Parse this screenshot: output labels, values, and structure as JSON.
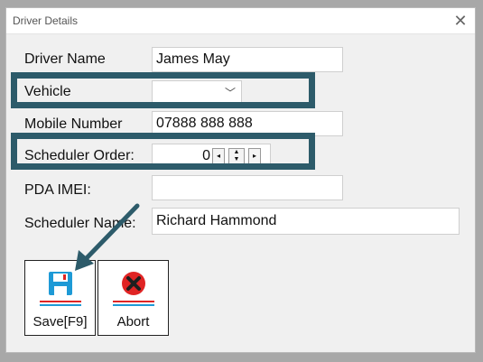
{
  "window": {
    "title": "Driver Details",
    "close_glyph": "✕"
  },
  "form": {
    "driver_name": {
      "label": "Driver Name",
      "value": "James May"
    },
    "vehicle": {
      "label": "Vehicle",
      "value": ""
    },
    "mobile_number": {
      "label": "Mobile Number",
      "value": "07888 888 888"
    },
    "scheduler_order": {
      "label": "Scheduler Order:",
      "value": "0"
    },
    "pda_imei": {
      "label": "PDA IMEI:",
      "value": ""
    },
    "scheduler_name": {
      "label": "Scheduler Name:",
      "value": "Richard Hammond"
    }
  },
  "buttons": {
    "save": {
      "label": "Save[F9]",
      "icon": "floppy-disk-icon"
    },
    "abort": {
      "label": "Abort",
      "icon": "red-x-icon"
    }
  },
  "colors": {
    "highlight": "#2d5b6a",
    "save_icon": "#1e9ad6",
    "abort_red": "#e02424"
  }
}
